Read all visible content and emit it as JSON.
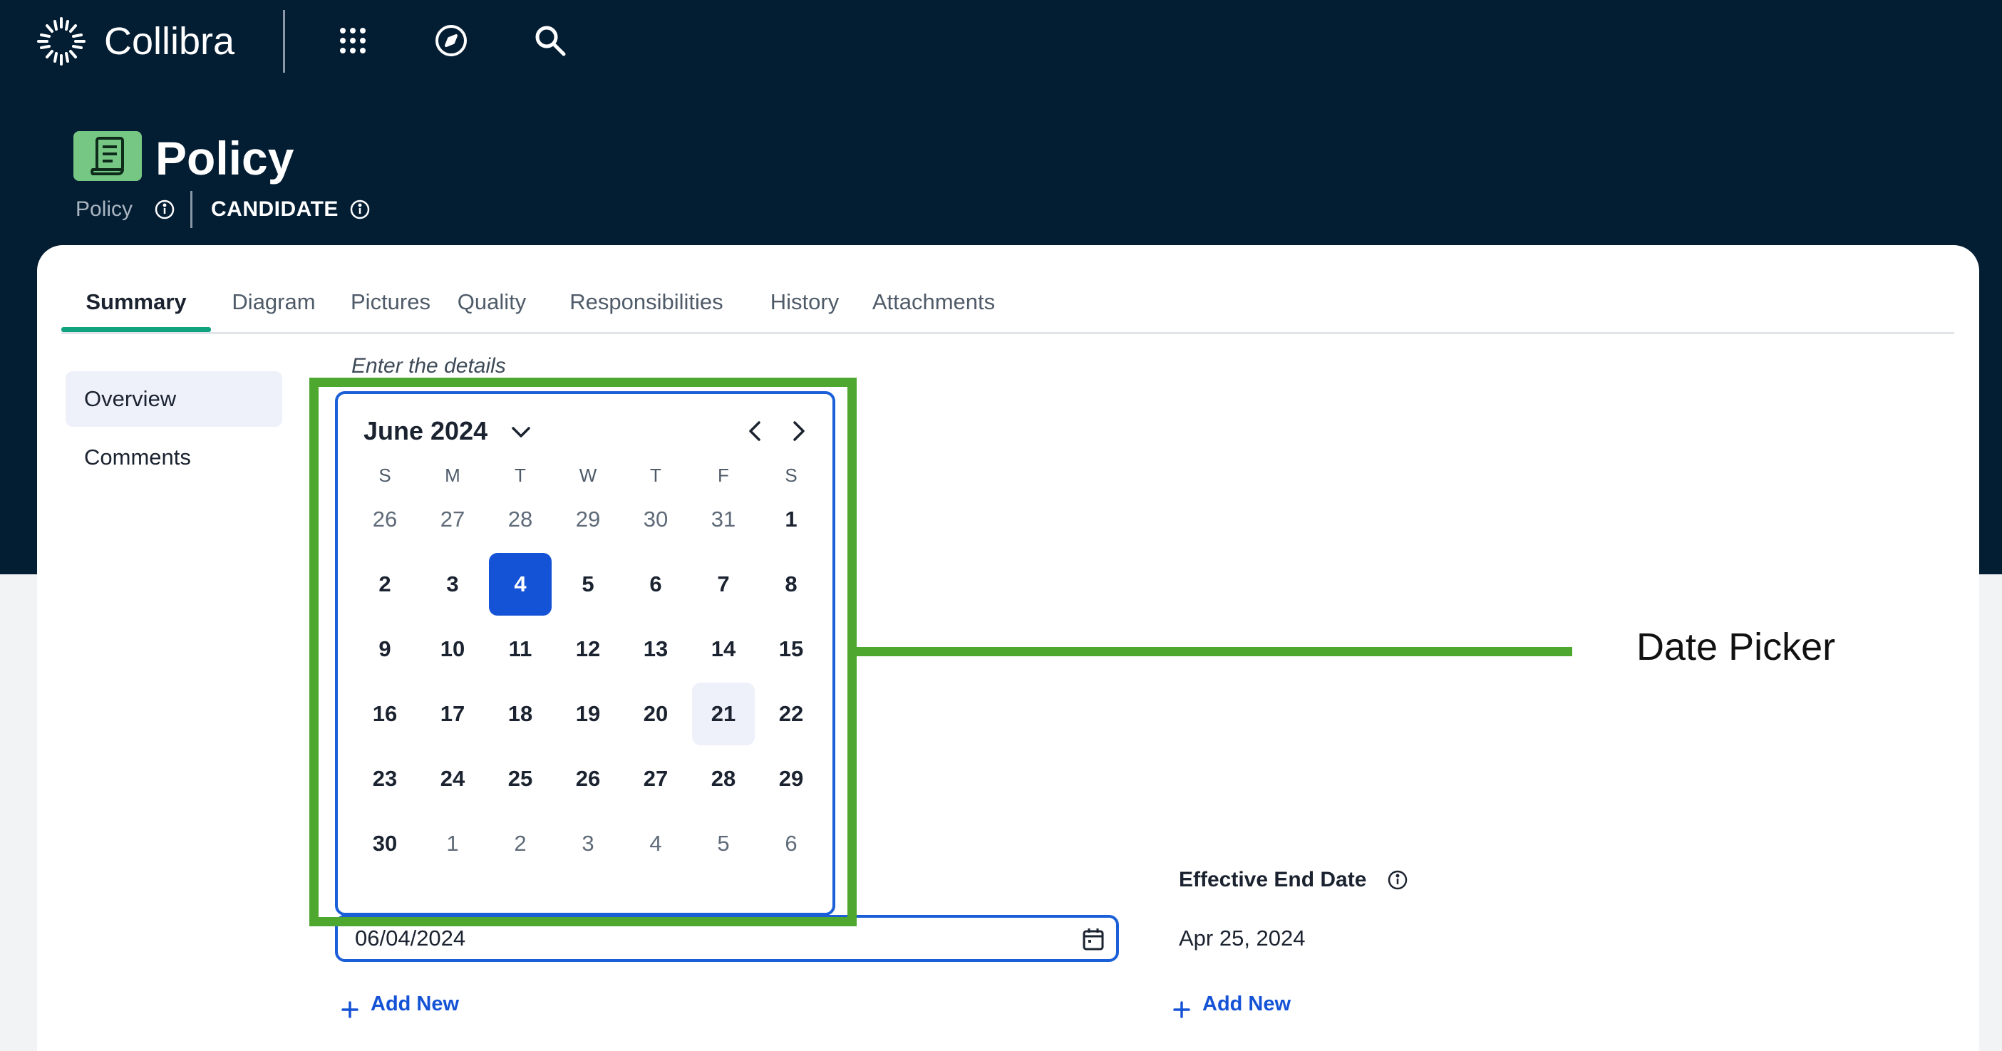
{
  "app": {
    "brand": "Collibra"
  },
  "asset": {
    "title": "Policy",
    "type": "Policy",
    "status": "CANDIDATE"
  },
  "tabs": [
    {
      "label": "Summary"
    },
    {
      "label": "Diagram"
    },
    {
      "label": "Pictures"
    },
    {
      "label": "Quality"
    },
    {
      "label": "Responsibilities"
    },
    {
      "label": "History"
    },
    {
      "label": "Attachments"
    }
  ],
  "sidebar": {
    "items": [
      {
        "label": "Overview"
      },
      {
        "label": "Comments"
      }
    ]
  },
  "form": {
    "helper": "Enter the details",
    "date_input_value": "06/04/2024",
    "add_new_label": "Add New",
    "end_date_label": "Effective End Date",
    "end_date_value": "Apr 25, 2024"
  },
  "calendar": {
    "month_label": "June 2024",
    "weekdays": [
      "S",
      "M",
      "T",
      "W",
      "T",
      "F",
      "S"
    ],
    "weeks": [
      [
        "26",
        "27",
        "28",
        "29",
        "30",
        "31",
        "1"
      ],
      [
        "2",
        "3",
        "4",
        "5",
        "6",
        "7",
        "8"
      ],
      [
        "9",
        "10",
        "11",
        "12",
        "13",
        "14",
        "15"
      ],
      [
        "16",
        "17",
        "18",
        "19",
        "20",
        "21",
        "22"
      ],
      [
        "23",
        "24",
        "25",
        "26",
        "27",
        "28",
        "29"
      ],
      [
        "30",
        "1",
        "2",
        "3",
        "4",
        "5",
        "6"
      ]
    ],
    "selected_day": "4",
    "highlighted_day": "21"
  },
  "annotation": {
    "label": "Date Picker"
  },
  "colors": {
    "header_bg": "#031d33",
    "accent_green": "#4ea72e",
    "tab_underline": "#0fa37f",
    "primary_blue": "#1553d6"
  }
}
